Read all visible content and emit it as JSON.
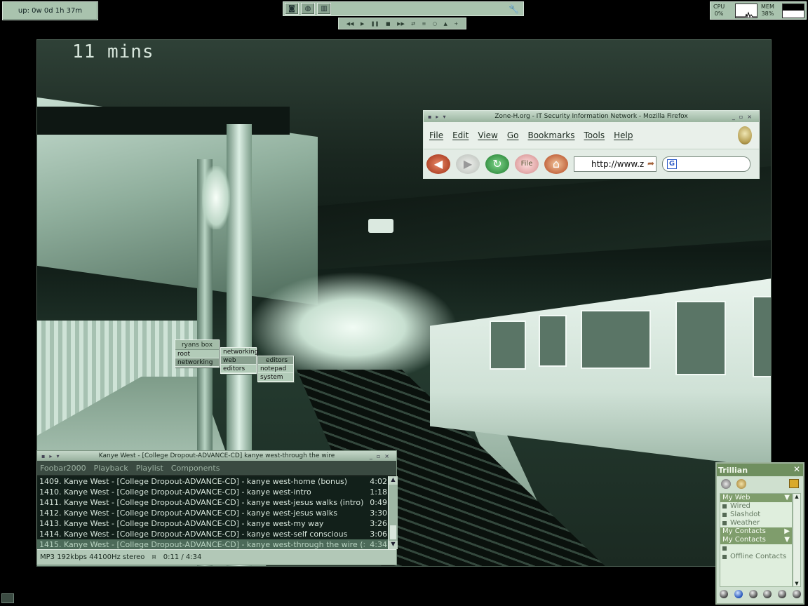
{
  "uptime": {
    "text": "up: 0w 0d 1h 37m"
  },
  "sysmon": {
    "cpu_label": "CPU",
    "cpu_value": "0%",
    "mem_label": "MEM",
    "mem_value": "38%"
  },
  "wallpaper": {
    "sign_text": "11 mins"
  },
  "firefox": {
    "title": "Zone-H.org - IT Security Information Network - Mozilla Firefox",
    "menu": [
      "File",
      "Edit",
      "View",
      "Go",
      "Bookmarks",
      "Tools",
      "Help"
    ],
    "url": "http://www.z",
    "file_button": "File"
  },
  "context_menu": {
    "header": "ryans box",
    "level1": [
      "root",
      "networking"
    ],
    "level2": [
      "networking",
      "web",
      "editors"
    ],
    "level3": [
      "editors",
      "notepad",
      "system"
    ]
  },
  "foobar": {
    "title": "Kanye West - [College Dropout-ADVANCE-CD] kanye west-through the wire",
    "menu": [
      "Foobar2000",
      "Playback",
      "Playlist",
      "Components"
    ],
    "tracks": [
      {
        "text": "1409. Kanye West - [College Dropout-ADVANCE-CD] - kanye west-home (bonus)",
        "dur": "4:02"
      },
      {
        "text": "1410. Kanye West - [College Dropout-ADVANCE-CD] - kanye west-intro",
        "dur": "1:18"
      },
      {
        "text": "1411. Kanye West - [College Dropout-ADVANCE-CD] - kanye west-jesus walks (intro)",
        "dur": "0:49"
      },
      {
        "text": "1412. Kanye West - [College Dropout-ADVANCE-CD] - kanye west-jesus walks",
        "dur": "3:30"
      },
      {
        "text": "1413. Kanye West - [College Dropout-ADVANCE-CD] - kanye west-my way",
        "dur": "3:26"
      },
      {
        "text": "1414. Kanye West - [College Dropout-ADVANCE-CD] - kanye west-self conscious",
        "dur": "3:06"
      },
      {
        "text": "1415. Kanye West - [College Dropout-ADVANCE-CD] - kanye west-through the wire (>",
        "dur": "4:34"
      }
    ],
    "current_index": 6,
    "status": "MP3 192kbps 44100Hz stereo",
    "play_symbol": "¤",
    "time": "0:11 / 4:34"
  },
  "trillian": {
    "title": "Trillian",
    "close": "✕",
    "groups": [
      {
        "label": "My Web",
        "header": true,
        "arrow": "▼"
      },
      {
        "label": "Wired",
        "header": false
      },
      {
        "label": "Slashdot",
        "header": false
      },
      {
        "label": "Weather",
        "header": false
      },
      {
        "label": "My Contacts",
        "header": true,
        "arrow": "▶"
      },
      {
        "label": "My Contacts",
        "header": true,
        "arrow": "▼"
      },
      {
        "label": "",
        "header": false
      },
      {
        "label": "Offline Contacts",
        "header": false
      }
    ]
  }
}
